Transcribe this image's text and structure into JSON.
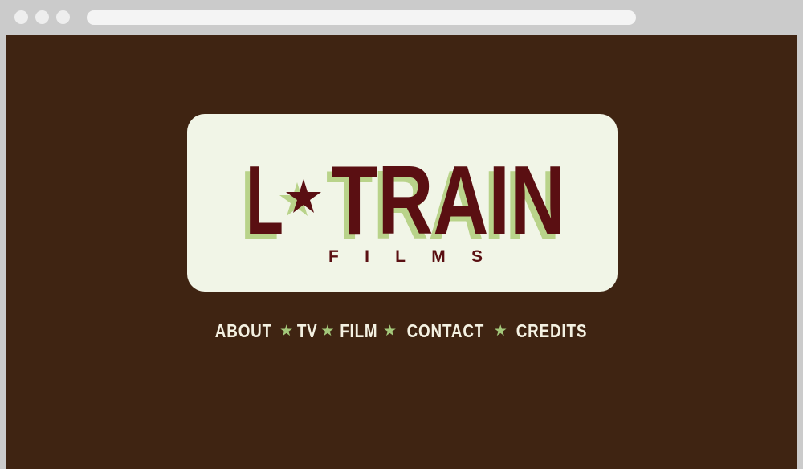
{
  "browser": {
    "window_controls": [
      "close-dot",
      "minimize-dot",
      "maximize-dot"
    ],
    "address_bar_text": ""
  },
  "logo": {
    "word_left": "L",
    "word_right": "TRAIN",
    "star_icon": "star-icon",
    "subtitle": "FILMS"
  },
  "nav": {
    "items": [
      {
        "label": "ABOUT"
      },
      {
        "label": "TV"
      },
      {
        "label": "FILM"
      },
      {
        "label": "CONTACT"
      },
      {
        "label": "CREDITS"
      }
    ],
    "separator_icon": "star-icon",
    "separator_glyph": "★"
  },
  "colors": {
    "page_background": "#3f2412",
    "chrome_background": "#cbcbcb",
    "logo_card": "#f1f5e7",
    "logo_main": "#5a0f12",
    "logo_shadow": "#b9d38a",
    "nav_text": "#f4f1e2",
    "nav_star": "#a3c87a"
  }
}
